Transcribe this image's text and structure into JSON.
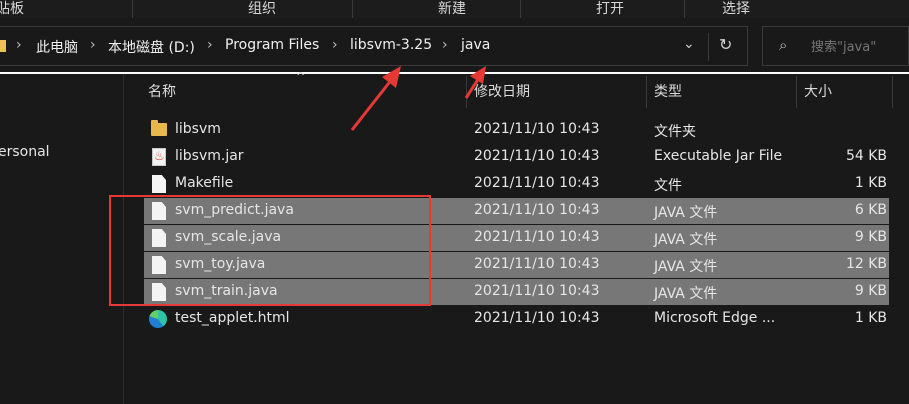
{
  "ribbon": {
    "clipboard": "贴板",
    "organize": "组织",
    "new": "新建",
    "open": "打开",
    "select": "选择"
  },
  "address": {
    "crumbs": [
      "此电脑",
      "本地磁盘 (D:)",
      "Program Files",
      "libsvm-3.25",
      "java"
    ]
  },
  "search": {
    "placeholder": "搜索\"java\""
  },
  "nav": {
    "personal": "ersonal"
  },
  "columns": {
    "name": "名称",
    "date": "修改日期",
    "type": "类型",
    "size": "大小"
  },
  "files": [
    {
      "name": "libsvm",
      "date": "2021/11/10 10:43",
      "type": "文件夹",
      "size": "",
      "icon": "folder-icon",
      "selected": false
    },
    {
      "name": "libsvm.jar",
      "date": "2021/11/10 10:43",
      "type": "Executable Jar File",
      "size": "54 KB",
      "icon": "java-jar-icon",
      "selected": false
    },
    {
      "name": "Makefile",
      "date": "2021/11/10 10:43",
      "type": "文件",
      "size": "1 KB",
      "icon": "file-icon",
      "selected": false
    },
    {
      "name": "svm_predict.java",
      "date": "2021/11/10 10:43",
      "type": "JAVA 文件",
      "size": "6 KB",
      "icon": "file-icon",
      "selected": true
    },
    {
      "name": "svm_scale.java",
      "date": "2021/11/10 10:43",
      "type": "JAVA 文件",
      "size": "9 KB",
      "icon": "file-icon",
      "selected": true
    },
    {
      "name": "svm_toy.java",
      "date": "2021/11/10 10:43",
      "type": "JAVA 文件",
      "size": "12 KB",
      "icon": "file-icon",
      "selected": true
    },
    {
      "name": "svm_train.java",
      "date": "2021/11/10 10:43",
      "type": "JAVA 文件",
      "size": "9 KB",
      "icon": "file-icon",
      "selected": true
    },
    {
      "name": "test_applet.html",
      "date": "2021/11/10 10:43",
      "type": "Microsoft Edge ...",
      "size": "1 KB",
      "icon": "edge-html-icon",
      "selected": false
    }
  ],
  "colors": {
    "background": "#191919",
    "selection": "#777777",
    "annotation": "#e53935"
  }
}
